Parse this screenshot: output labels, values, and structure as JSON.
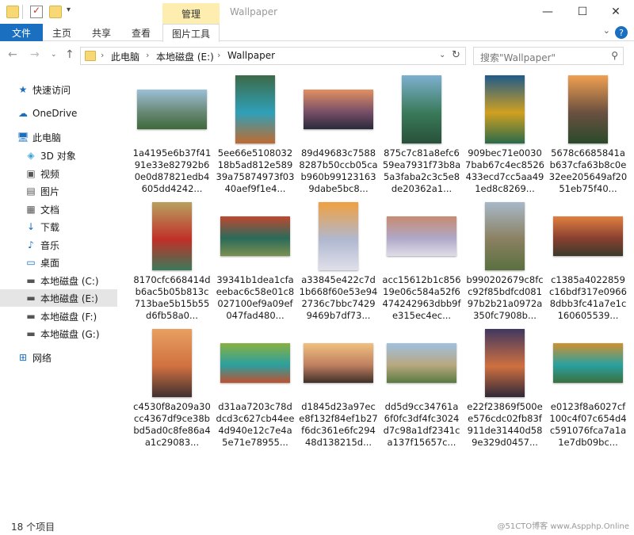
{
  "window": {
    "title": "Wallpaper",
    "context_tab_label": "管理",
    "controls": {
      "minimize": "—",
      "maximize": "☐",
      "close": "✕"
    }
  },
  "ribbon": {
    "tabs": [
      "文件",
      "主页",
      "共享",
      "查看",
      "图片工具"
    ],
    "active_tab": "文件",
    "accent_color": "#1a6fc0",
    "context_color": "#fdeeb0"
  },
  "address": {
    "crumbs": [
      "此电脑",
      "本地磁盘 (E:)",
      "Wallpaper"
    ],
    "separator": "›",
    "search_placeholder": "搜索\"Wallpaper\""
  },
  "sidebar": {
    "items": [
      {
        "label": "快速访问",
        "icon": "star-icon",
        "glyph": "★",
        "color": "#1a6fc0"
      },
      {
        "label": "OneDrive",
        "icon": "cloud-icon",
        "glyph": "☁",
        "color": "#1a6fc0"
      },
      {
        "label": "此电脑",
        "icon": "computer-icon",
        "glyph": "🖥",
        "color": "#1a6fc0"
      },
      {
        "label": "3D 对象",
        "icon": "cube-icon",
        "glyph": "◈",
        "color": "#3aa0d8"
      },
      {
        "label": "视频",
        "icon": "video-icon",
        "glyph": "▣",
        "color": "#555"
      },
      {
        "label": "图片",
        "icon": "picture-icon",
        "glyph": "▤",
        "color": "#555"
      },
      {
        "label": "文档",
        "icon": "document-icon",
        "glyph": "▦",
        "color": "#555"
      },
      {
        "label": "下载",
        "icon": "download-icon",
        "glyph": "↓",
        "color": "#1a6fc0"
      },
      {
        "label": "音乐",
        "icon": "music-icon",
        "glyph": "♪",
        "color": "#1a6fc0"
      },
      {
        "label": "桌面",
        "icon": "desktop-icon",
        "glyph": "▭",
        "color": "#1a6fc0"
      },
      {
        "label": "本地磁盘 (C:)",
        "icon": "drive-icon",
        "glyph": "▬",
        "color": "#555"
      },
      {
        "label": "本地磁盘 (E:)",
        "icon": "drive-icon",
        "glyph": "▬",
        "color": "#555",
        "selected": true
      },
      {
        "label": "本地磁盘 (F:)",
        "icon": "drive-icon",
        "glyph": "▬",
        "color": "#555"
      },
      {
        "label": "本地磁盘 (G:)",
        "icon": "drive-icon",
        "glyph": "▬",
        "color": "#555"
      },
      {
        "label": "网络",
        "icon": "network-icon",
        "glyph": "⊞",
        "color": "#1a6fc0"
      }
    ]
  },
  "files": [
    {
      "name": "1a4195e6b37f4191e33e82792b60e0d87821edb4605dd4242...",
      "orientation": "land",
      "colors": [
        "#9cc0d8",
        "#6a8a78",
        "#3d6a3a"
      ]
    },
    {
      "name": "5ee66e510803218b5ad812e58939a75874973f0340aef9f1e4...",
      "orientation": "port",
      "colors": [
        "#3c6a48",
        "#2fa0b8",
        "#c06a30"
      ]
    },
    {
      "name": "89d49683c75888287b50ccb05cab960b991231639dabe5bc8...",
      "orientation": "land",
      "colors": [
        "#e39060",
        "#7a5068",
        "#2a2a3a"
      ]
    },
    {
      "name": "875c7c81a8efc659ea7931f73b8a5a3faba2c3c5e8de20362a1...",
      "orientation": "port",
      "colors": [
        "#7db0d0",
        "#3a7a5a",
        "#28503a"
      ]
    },
    {
      "name": "909bec71e00307bab67c4ec8526433ecd7cc5aa491ed8c8269...",
      "orientation": "port",
      "colors": [
        "#1f5a8a",
        "#d0a020",
        "#2a6a4a"
      ]
    },
    {
      "name": "5678c6685841ab637cfa63b8c0e32ee205649af2051eb75f40...",
      "orientation": "port",
      "colors": [
        "#f0a050",
        "#6a5040",
        "#2a4a2a"
      ]
    },
    {
      "name": "8170cfc668414db6ac5b05b813c713bae5b15b55d6fb58a0...",
      "orientation": "port",
      "colors": [
        "#b8a060",
        "#c03028",
        "#3a7a5a"
      ]
    },
    {
      "name": "39341b1dea1cfaeebac6c58e01c8027100ef9a09ef047fad480...",
      "orientation": "land",
      "colors": [
        "#c04830",
        "#2a6a5a",
        "#7a9050"
      ]
    },
    {
      "name": "a33845e422c7d1b668f60e53e942736c7bbc74299469b7df73...",
      "orientation": "port",
      "colors": [
        "#f0a040",
        "#b0b8d0",
        "#e0e0ea"
      ]
    },
    {
      "name": "acc15612b1c85619e06c584a52f6474242963dbb9fe315ec4ec...",
      "orientation": "land",
      "colors": [
        "#c88a70",
        "#b0a8c8",
        "#e0dce8"
      ]
    },
    {
      "name": "b990202679c8fcc92f85bdfcd08197b2b21a0972a350fc7908b...",
      "orientation": "port",
      "colors": [
        "#a8b8c8",
        "#8a8060",
        "#5a7040"
      ]
    },
    {
      "name": "c1385a4022859c16bdf317e09668dbb3fc41a7e1c160605539...",
      "orientation": "land",
      "colors": [
        "#e08040",
        "#8a4030",
        "#3a3a2a"
      ]
    },
    {
      "name": "c4530f8a209a30cc4367df9ce38bbd5ad0c8fe86a4a1c29083...",
      "orientation": "port",
      "colors": [
        "#e8a060",
        "#d07040",
        "#403030"
      ]
    },
    {
      "name": "d31aa7203c78ddcd3c627cb44ee4d940e12c7e4a5e71e78955...",
      "orientation": "land",
      "colors": [
        "#8ab040",
        "#2aa0a0",
        "#c05030"
      ]
    },
    {
      "name": "d1845d23a97ece8f132f84ef1b27f6dc361e6fc29448d138215d...",
      "orientation": "land",
      "colors": [
        "#f0c080",
        "#c08060",
        "#403028"
      ]
    },
    {
      "name": "dd5d9cc34761a6f0fc3df4fc3024d7c98a1df2341ca137f15657c...",
      "orientation": "land",
      "colors": [
        "#a0c0e0",
        "#b8a880",
        "#5a7a40"
      ]
    },
    {
      "name": "e22f23869f500ee576cdc02fb83f911de31440d589e329d0457...",
      "orientation": "port",
      "colors": [
        "#403860",
        "#d07040",
        "#302838"
      ]
    },
    {
      "name": "e0123f8a6027cf100c4f07c654d4c591076fca7a1a1e7db09bc...",
      "orientation": "land",
      "colors": [
        "#d09030",
        "#2aa0a0",
        "#3a7040"
      ]
    }
  ],
  "status": {
    "count": "18 个项目",
    "watermark": "@51CTO博客 www.Aspphp.Online"
  }
}
